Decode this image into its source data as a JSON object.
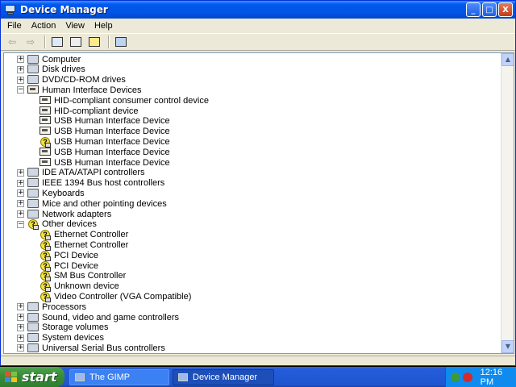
{
  "window": {
    "title": "Device Manager",
    "controls": {
      "minimize": "_",
      "maximize": "□",
      "close": "X"
    }
  },
  "menu": [
    "File",
    "Action",
    "View",
    "Help"
  ],
  "toolbar": {
    "buttons": [
      "back-icon",
      "forward-icon",
      "properties-icon",
      "print-icon",
      "help-icon",
      "scan-hardware-icon"
    ]
  },
  "tree": [
    {
      "label": "Computer",
      "level": 0,
      "expander": "+",
      "icon": "computer-icon"
    },
    {
      "label": "Disk drives",
      "level": 0,
      "expander": "+",
      "icon": "disk-icon"
    },
    {
      "label": "DVD/CD-ROM drives",
      "level": 0,
      "expander": "+",
      "icon": "cdrom-icon"
    },
    {
      "label": "Human Interface Devices",
      "level": 0,
      "expander": "-",
      "icon": "hid-icon"
    },
    {
      "label": "HID-compliant consumer control device",
      "level": 1,
      "expander": "",
      "icon": "hid-icon"
    },
    {
      "label": "HID-compliant device",
      "level": 1,
      "expander": "",
      "icon": "hid-icon"
    },
    {
      "label": "USB Human Interface Device",
      "level": 1,
      "expander": "",
      "icon": "hid-icon"
    },
    {
      "label": "USB Human Interface Device",
      "level": 1,
      "expander": "",
      "icon": "hid-icon"
    },
    {
      "label": "USB Human Interface Device",
      "level": 1,
      "expander": "",
      "icon": "hid-warning-icon"
    },
    {
      "label": "USB Human Interface Device",
      "level": 1,
      "expander": "",
      "icon": "hid-icon"
    },
    {
      "label": "USB Human Interface Device",
      "level": 1,
      "expander": "",
      "icon": "hid-icon"
    },
    {
      "label": "IDE ATA/ATAPI controllers",
      "level": 0,
      "expander": "+",
      "icon": "ide-icon"
    },
    {
      "label": "IEEE 1394 Bus host controllers",
      "level": 0,
      "expander": "+",
      "icon": "firewire-icon"
    },
    {
      "label": "Keyboards",
      "level": 0,
      "expander": "+",
      "icon": "keyboard-icon"
    },
    {
      "label": "Mice and other pointing devices",
      "level": 0,
      "expander": "+",
      "icon": "mouse-icon"
    },
    {
      "label": "Network adapters",
      "level": 0,
      "expander": "+",
      "icon": "network-icon"
    },
    {
      "label": "Other devices",
      "level": 0,
      "expander": "-",
      "icon": "unknown-device-icon"
    },
    {
      "label": "Ethernet Controller",
      "level": 1,
      "expander": "",
      "icon": "unknown-device-icon"
    },
    {
      "label": "Ethernet Controller",
      "level": 1,
      "expander": "",
      "icon": "unknown-device-icon"
    },
    {
      "label": "PCI Device",
      "level": 1,
      "expander": "",
      "icon": "unknown-device-icon"
    },
    {
      "label": "PCI Device",
      "level": 1,
      "expander": "",
      "icon": "unknown-device-icon"
    },
    {
      "label": "SM Bus Controller",
      "level": 1,
      "expander": "",
      "icon": "unknown-device-icon"
    },
    {
      "label": "Unknown device",
      "level": 1,
      "expander": "",
      "icon": "unknown-device-icon"
    },
    {
      "label": "Video Controller (VGA Compatible)",
      "level": 1,
      "expander": "",
      "icon": "unknown-device-icon"
    },
    {
      "label": "Processors",
      "level": 0,
      "expander": "+",
      "icon": "processor-icon"
    },
    {
      "label": "Sound, video and game controllers",
      "level": 0,
      "expander": "+",
      "icon": "sound-icon"
    },
    {
      "label": "Storage volumes",
      "level": 0,
      "expander": "+",
      "icon": "storage-icon"
    },
    {
      "label": "System devices",
      "level": 0,
      "expander": "+",
      "icon": "system-icon"
    },
    {
      "label": "Universal Serial Bus controllers",
      "level": 0,
      "expander": "+",
      "icon": "usb-icon"
    }
  ],
  "taskbar": {
    "start_label": "start",
    "tasks": [
      {
        "label": "The GIMP",
        "active": false
      },
      {
        "label": "Device Manager",
        "active": true
      }
    ],
    "clock": "12:16 PM"
  },
  "colors": {
    "titlebar": "#0054E3",
    "window_bg": "#ECE9D8",
    "taskbar": "#245DDB",
    "start": "#3A8D3A",
    "tray": "#0F8BEF"
  }
}
